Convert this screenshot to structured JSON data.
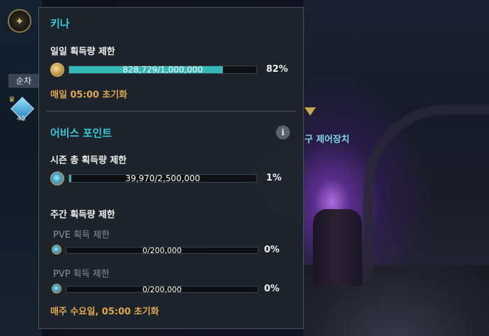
{
  "background": {
    "rank_tab": "순차",
    "guardian_level": "45",
    "objective_text": "구 제어장치"
  },
  "panel": {
    "kina": {
      "title": "키나",
      "daily_label": "일일 획득량 제한",
      "daily_value_text": "828,729/1,000,000",
      "daily_fraction": 0.82,
      "daily_percent": "82%",
      "reset_text": "매일 05:00 초기화"
    },
    "abyss": {
      "title": "어비스 포인트",
      "info_glyph": "i",
      "season_label": "시즌 총 획득량 제한",
      "season_value_text": "39,970/2,500,000",
      "season_fraction": 0.01,
      "season_percent": "1%",
      "weekly_label": "주간 획득량 제한",
      "pve_label": "PVE 획득 제한",
      "pve_value_text": "0/200,000",
      "pve_fraction": 0,
      "pve_percent": "0%",
      "pvp_label": "PVP 획득 제한",
      "pvp_value_text": "0/200,000",
      "pvp_fraction": 0,
      "pvp_percent": "0%",
      "reset_text": "매주 수요일, 05:00 초기화"
    }
  },
  "colors": {
    "title_accent": "#39c9d6",
    "reset_accent": "#e0a850",
    "bar_fill": "#34b8b8"
  },
  "icons": {
    "kina": "kina-coin-icon",
    "abyss": "abyss-point-icon",
    "info": "info-icon"
  }
}
